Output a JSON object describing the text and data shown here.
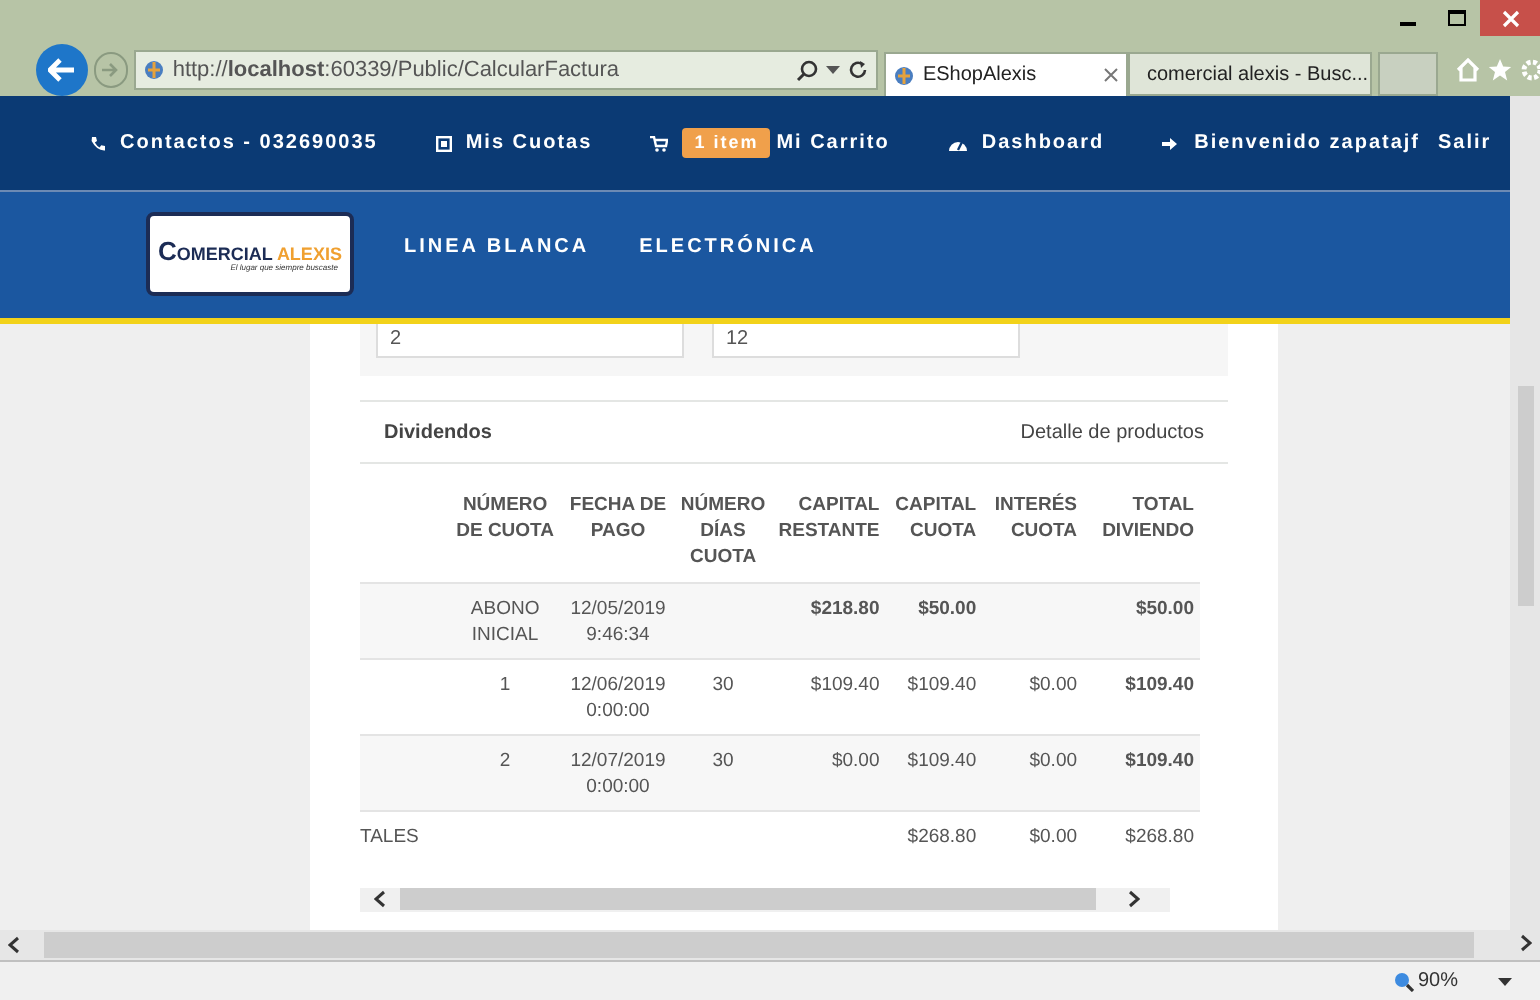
{
  "browser": {
    "address": "http://**localhost**:60339/Public/CalcularFactura",
    "tabs": [
      {
        "title": "EShopAlexis",
        "selected": true
      },
      {
        "title": "comercial alexis - Busc...",
        "selected": false
      }
    ]
  },
  "top_nav": [
    {
      "label": "Contactos - 032690035"
    },
    {
      "label": "Mis Cuotas"
    },
    {
      "label": "Mi Carrito",
      "badge": "1 item"
    },
    {
      "label": "Dashboard"
    },
    {
      "label": "Bienvenido zapatajf"
    },
    {
      "label": "Salir"
    }
  ],
  "logo": {
    "title": "COMERCIAL ALEXIS",
    "tagline": "El lugar que siempre buscaste"
  },
  "categories": [
    "LINEA BLANCA",
    "ELECTRÓNICA"
  ],
  "form_fields": [
    {
      "value": "2"
    },
    {
      "value": "12"
    }
  ],
  "panel": {
    "title": "Dividendos",
    "link": "Detalle de productos"
  },
  "table": {
    "columns": [
      "NÚMERO DE CUOTA",
      "FECHA DE PAGO",
      "NÚMERO DÍAS CUOTA",
      "CAPITAL RESTANTE",
      "CAPITAL CUOTA",
      "INTERÉS CUOTA",
      "TOTAL DIVIENDO"
    ],
    "rows": [
      {
        "cells": [
          {
            "text": "ABONO INICIAL",
            "bold": false
          },
          {
            "text": "12/05/2019 9:46:34",
            "bold": false
          },
          null,
          {
            "text": "$218.80",
            "bold": true
          },
          {
            "text": "$50.00",
            "bold": true
          },
          null,
          {
            "text": "$50.00",
            "bold": true
          }
        ]
      },
      {
        "cells": [
          {
            "text": "1",
            "bold": false
          },
          {
            "text": "12/06/2019 0:00:00",
            "bold": false
          },
          {
            "text": "30",
            "bold": false
          },
          {
            "text": "$109.40",
            "bold": false
          },
          {
            "text": "$109.40",
            "bold": false
          },
          {
            "text": "$0.00",
            "bold": false
          },
          {
            "text": "$109.40",
            "bold": true
          }
        ]
      },
      {
        "cells": [
          {
            "text": "2",
            "bold": false
          },
          {
            "text": "12/07/2019 0:00:00",
            "bold": false
          },
          {
            "text": "30",
            "bold": false
          },
          {
            "text": "$0.00",
            "bold": false
          },
          {
            "text": "$109.40",
            "bold": false
          },
          {
            "text": "$0.00",
            "bold": false
          },
          {
            "text": "$109.40",
            "bold": true
          }
        ]
      }
    ],
    "totals": {
      "label": "TALES",
      "cells": [
        null,
        null,
        null,
        null,
        "$268.80",
        "$0.00",
        "$268.80"
      ]
    }
  },
  "status_bar": {
    "zoom": "90%"
  }
}
